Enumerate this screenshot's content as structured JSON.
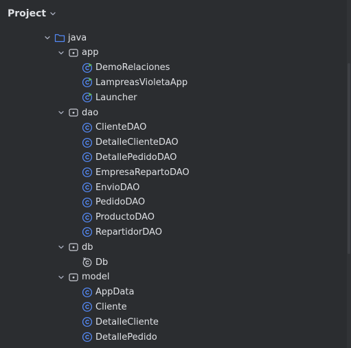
{
  "header": {
    "title": "Project"
  },
  "tree": {
    "root": {
      "label": "java"
    },
    "packages": [
      {
        "label": "app",
        "files": [
          "DemoRelaciones",
          "LampreasVioletaApp",
          "Launcher"
        ]
      },
      {
        "label": "dao",
        "files": [
          "ClienteDAO",
          "DetalleClienteDAO",
          "DetallePedidoDAO",
          "EmpresaRepartoDAO",
          "EnvioDAO",
          "PedidoDAO",
          "ProductoDAO",
          "RepartidorDAO"
        ]
      },
      {
        "label": "db",
        "files": [
          "Db"
        ]
      },
      {
        "label": "model",
        "files": [
          "AppData",
          "Cliente",
          "DetalleCliente",
          "DetallePedido"
        ]
      }
    ]
  },
  "colors": {
    "background": "#2b2d30",
    "text": "#dfe1e5",
    "class_icon": "#548af7",
    "folder_icon": "#548af7",
    "run_badge": "#5fb865"
  }
}
